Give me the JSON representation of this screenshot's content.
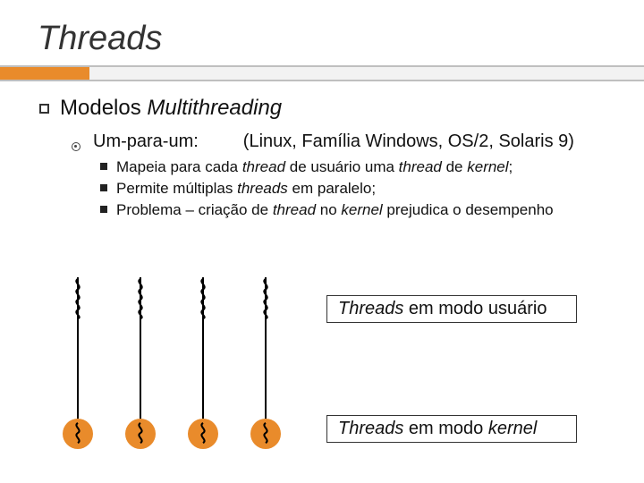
{
  "title": "Threads",
  "lvl1_prefix": "Modelos ",
  "lvl1_em": "Multithreading",
  "lvl2_label": "Um-para-um:",
  "lvl2_examples": "(Linux, Família Windows, OS/2, Solaris 9)",
  "bullets": {
    "b0_a": "Mapeia para cada ",
    "b0_b": "thread",
    "b0_c": " de usuário uma ",
    "b0_d": "thread",
    "b0_e": " de ",
    "b0_f": "kernel",
    "b0_g": ";",
    "b1_a": "Permite múltiplas ",
    "b1_b": "threads",
    "b1_c": " em paralelo;",
    "b2_a": "Problema – criação de ",
    "b2_b": "thread",
    "b2_c": " no ",
    "b2_d": "kernel",
    "b2_e": " prejudica o desempenho"
  },
  "labels": {
    "user_a": "Threads",
    "user_b": " em modo usuário",
    "kernel_a": "Threads",
    "kernel_b": " em modo ",
    "kernel_c": "kernel"
  },
  "thread_positions": [
    0,
    70,
    140,
    210
  ],
  "colors": {
    "accent": "#e98b2b"
  }
}
